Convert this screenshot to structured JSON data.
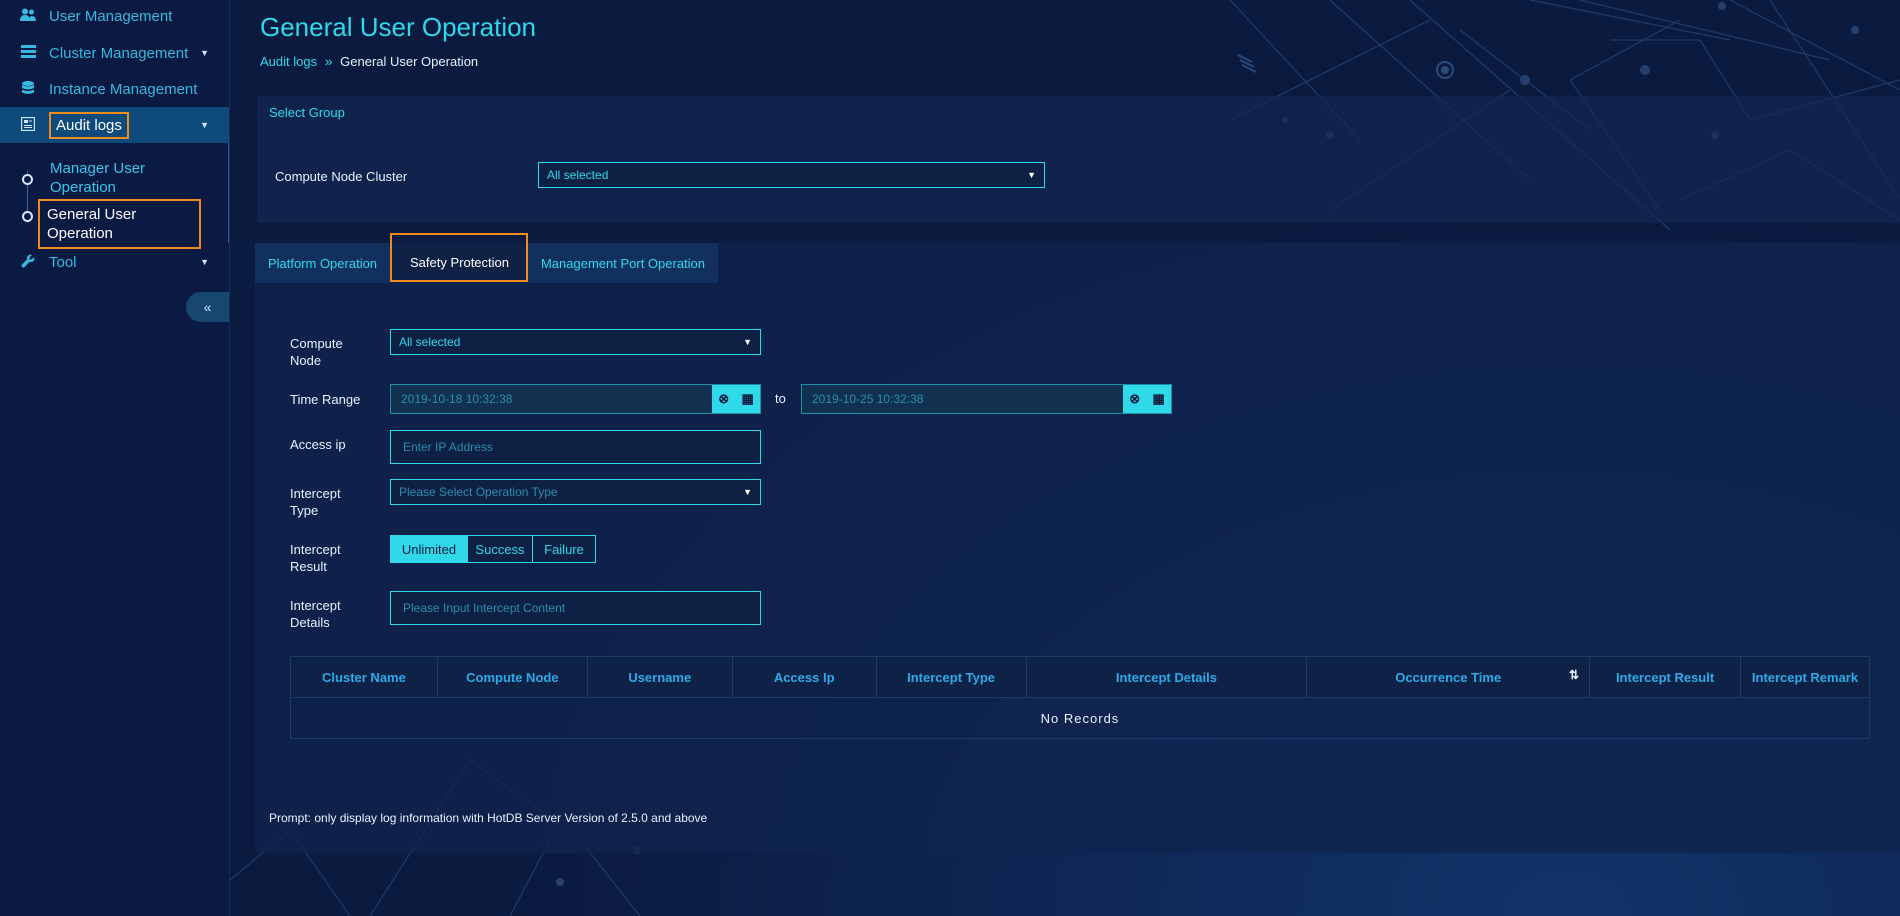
{
  "sidebar": {
    "items": [
      {
        "label": "User Management",
        "icon": "users-icon"
      },
      {
        "label": "Cluster Management",
        "icon": "server-stack-icon"
      },
      {
        "label": "Instance Management",
        "icon": "database-icon"
      },
      {
        "label": "Audit logs",
        "icon": "log-book-icon"
      },
      {
        "label": "Tool",
        "icon": "wrench-icon"
      }
    ],
    "sub_items": [
      {
        "label": "Manager User Operation"
      },
      {
        "label": "General User Operation"
      }
    ],
    "collapse_icon": "double-chevron-left-icon"
  },
  "page": {
    "title": "General User Operation",
    "breadcrumb": {
      "link": "Audit logs",
      "separator": "»",
      "current": "General User Operation"
    }
  },
  "select_group": {
    "title": "Select Group",
    "cluster_label": "Compute Node Cluster",
    "cluster_value": "All selected"
  },
  "tabs": [
    {
      "label": "Platform Operation"
    },
    {
      "label": "Safety Protection",
      "active": true
    },
    {
      "label": "Management Port Operation"
    }
  ],
  "form": {
    "compute_node_label": "Compute Node",
    "compute_node_value": "All selected",
    "time_range_label": "Time Range",
    "time_start": "2019-10-18 10:32:38",
    "time_to": "to",
    "time_end": "2019-10-25 10:32:38",
    "access_ip_label": "Access ip",
    "access_ip_placeholder": "Enter IP Address",
    "intercept_type_label": "Intercept Type",
    "intercept_type_placeholder": "Please Select Operation Type",
    "intercept_result_label": "Intercept Result",
    "result_options": [
      "Unlimited",
      "Success",
      "Failure"
    ],
    "result_selected": "Unlimited",
    "intercept_details_label": "Intercept Details",
    "intercept_details_placeholder": "Please Input Intercept Content"
  },
  "table": {
    "columns": [
      "Cluster Name",
      "Compute Node",
      "Username",
      "Access Ip",
      "Intercept Type",
      "Intercept Details",
      "Occurrence Time",
      "Intercept Result",
      "Intercept Remark"
    ],
    "empty_text": "No Records",
    "sort_icon": "sort-desc-icon"
  },
  "footer": {
    "prompt": "Prompt: only display log information with HotDB Server Version of 2.5.0 and above"
  },
  "colors": {
    "accent": "#2fd9ea",
    "highlight_box": "#f08c1e",
    "background": "#0b1a3f",
    "sidebar_active": "#0f4a7d"
  }
}
